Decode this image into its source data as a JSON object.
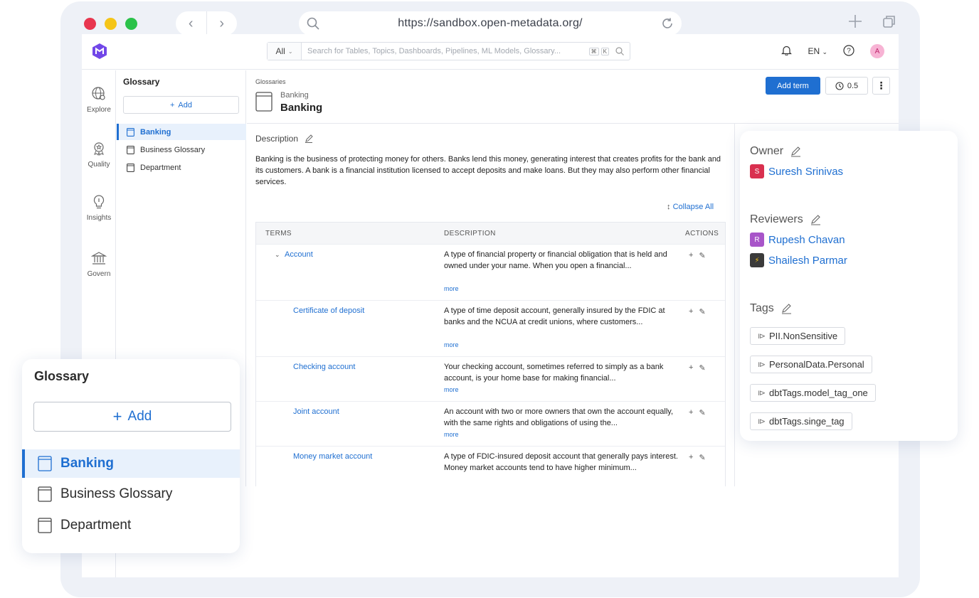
{
  "browser": {
    "url": "https://sandbox.open-metadata.org/",
    "traffic_lights": [
      "#e8364f",
      "#f5c518",
      "#2bc24a"
    ]
  },
  "topbar": {
    "search_scope": "All",
    "search_placeholder": "Search for Tables, Topics, Dashboards, Pipelines, ML Models, Glossary...",
    "shortcut_keys": [
      "⌘",
      "K"
    ],
    "language": "EN",
    "user_initial": "A"
  },
  "leftnav": {
    "items": [
      {
        "label": "Explore",
        "icon": "explore-icon"
      },
      {
        "label": "Quality",
        "icon": "quality-icon"
      },
      {
        "label": "Insights",
        "icon": "insights-icon"
      },
      {
        "label": "Govern",
        "icon": "govern-icon"
      }
    ]
  },
  "glossary_panel": {
    "title": "Glossary",
    "add_label": "Add",
    "items": [
      "Banking",
      "Business Glossary",
      "Department"
    ],
    "selected": "Banking"
  },
  "header": {
    "breadcrumb": "Glossaries",
    "subtitle": "Banking",
    "title": "Banking",
    "add_term_label": "Add term",
    "version": "0.5"
  },
  "description": {
    "label": "Description",
    "text": "Banking is the business of protecting money for others. Banks lend this money, generating interest that creates profits for the bank and its customers. A bank is a financial institution licensed to accept deposits and make loans. But they may also perform other financial services."
  },
  "terms_table": {
    "collapse_all_label": "Collapse All",
    "headers": [
      "TERMS",
      "DESCRIPTION",
      "ACTIONS"
    ],
    "more_label": "more",
    "rows": [
      {
        "term": "Account",
        "description": "A type of financial property or financial obligation that is held and owned under your name. When you open a financial...",
        "show_more": true
      },
      {
        "term": "Certificate of deposit",
        "description": "A type of time deposit account, generally insured by the FDIC at banks and the NCUA at credit unions, where customers...",
        "show_more": true
      },
      {
        "term": "Checking account",
        "description": "Your checking account, sometimes referred to simply as a bank account, is your home base for making financial...",
        "show_more": true
      },
      {
        "term": "Joint account",
        "description": "An account with two or more owners that own the account equally, with the same rights and obligations of using the...",
        "show_more": true
      },
      {
        "term": "Money market account",
        "description": "A type of FDIC-insured deposit account that generally pays interest. Money market accounts tend to have higher minimum...",
        "show_more": false
      }
    ]
  },
  "right_panel": {
    "owner_label": "Owner",
    "owner": {
      "name": "Suresh Srinivas",
      "initial": "S",
      "color": "#d9304f"
    },
    "reviewers_label": "Reviewers",
    "reviewers": [
      {
        "name": "Rupesh Chavan",
        "initial": "R",
        "color": "#a855c9"
      },
      {
        "name": "Shailesh Parmar",
        "initial": "⚡",
        "color": "#3b3b3b"
      }
    ],
    "tags_label": "Tags",
    "tags": [
      "PII.NonSensitive",
      "PersonalData.Personal",
      "dbtTags.model_tag_one",
      "dbtTags.singe_tag"
    ]
  },
  "zoom_card": {
    "title": "Glossary",
    "add_label": "Add",
    "items": [
      "Banking",
      "Business Glossary",
      "Department"
    ]
  },
  "colors": {
    "accent": "#1f6fd1",
    "brand": "#7147e8"
  }
}
